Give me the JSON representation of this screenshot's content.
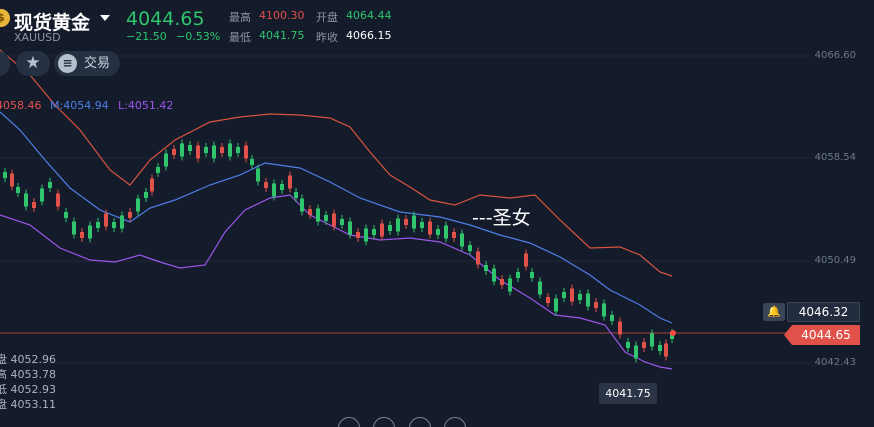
{
  "header": {
    "coin_symbol": "$",
    "title": "现货黄金",
    "symbol": "XAUUSD",
    "price": "4044.65",
    "change": "−21.50",
    "change_pct": "−0.53%",
    "stats": {
      "high_label": "最高",
      "high_value": "4100.30",
      "low_label": "最低",
      "low_value": "4041.75",
      "open_label": "开盘",
      "open_value": "4064.44",
      "prev_close_label": "昨收",
      "prev_close_value": "4066.15"
    }
  },
  "toolbar": {
    "star_icon": "★",
    "trade_icon": "≡",
    "trade_label": "交易"
  },
  "indicators": {
    "upper": "4058.46",
    "middle": "M:4054.94",
    "lower": "L:4051.42"
  },
  "axis": {
    "levels": [
      "4066.60",
      "4058.54",
      "4050.49",
      "4042.43"
    ]
  },
  "tags": {
    "alert_price": "4046.32",
    "current_price": "4044.65",
    "low_price": "4041.75"
  },
  "ohlc": {
    "open": "盘 4052.96",
    "high": "高 4053.78",
    "low": "低 4052.93",
    "close": "盘 4053.11"
  },
  "watermark": "---圣女",
  "colors": {
    "up": "#2ec56d",
    "down": "#e0514a",
    "upper_band": "#d9543f",
    "middle_band": "#4f7fe6",
    "lower_band": "#9a57e8",
    "bg": "#141b2b"
  },
  "icons": {
    "bell": "🔔"
  }
}
